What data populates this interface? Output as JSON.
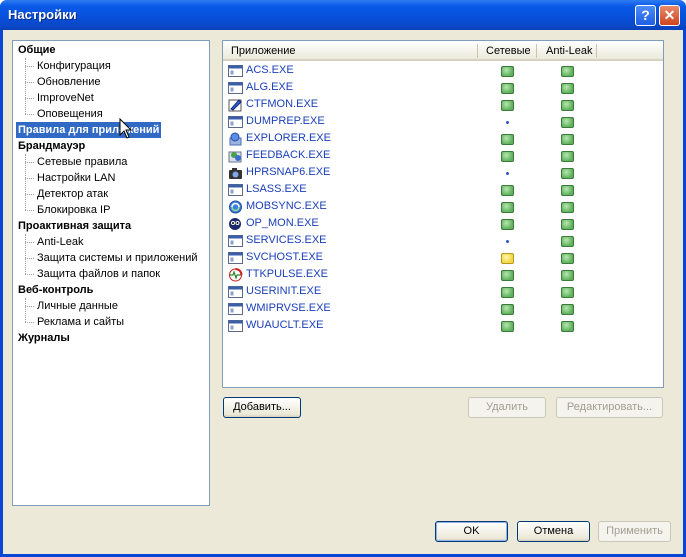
{
  "window": {
    "title": "Настройки",
    "help_button": "?",
    "close_button": "✕"
  },
  "tree": [
    {
      "label": "Общие",
      "type": "category"
    },
    {
      "label": "Конфигурация",
      "type": "item"
    },
    {
      "label": "Обновление",
      "type": "item"
    },
    {
      "label": "ImproveNet",
      "type": "item"
    },
    {
      "label": "Оповещения",
      "type": "item"
    },
    {
      "label": "Правила для приложений",
      "type": "category",
      "selected": true
    },
    {
      "label": "Брандмауэр",
      "type": "category"
    },
    {
      "label": "Сетевые правила",
      "type": "item"
    },
    {
      "label": "Настройки LAN",
      "type": "item"
    },
    {
      "label": "Детектор атак",
      "type": "item"
    },
    {
      "label": "Блокировка IP",
      "type": "item"
    },
    {
      "label": "Проактивная защита",
      "type": "category"
    },
    {
      "label": "Anti-Leak",
      "type": "item"
    },
    {
      "label": "Защита системы и приложений",
      "type": "item"
    },
    {
      "label": "Защита файлов и папок",
      "type": "item"
    },
    {
      "label": "Веб-контроль",
      "type": "category"
    },
    {
      "label": "Личные данные",
      "type": "item"
    },
    {
      "label": "Реклама и сайты",
      "type": "item"
    },
    {
      "label": "Журналы",
      "type": "category"
    }
  ],
  "list": {
    "columns": [
      "Приложение",
      "Сетевые",
      "Anti-Leak"
    ],
    "rows": [
      {
        "name": "ACS.EXE",
        "icon": "window-app-icon",
        "network": "green",
        "antileak": "green"
      },
      {
        "name": "ALG.EXE",
        "icon": "window-app-icon",
        "network": "green",
        "antileak": "green"
      },
      {
        "name": "CTFMON.EXE",
        "icon": "pen-app-icon",
        "network": "green",
        "antileak": "green"
      },
      {
        "name": "DUMPREP.EXE",
        "icon": "window-app-icon",
        "network": "none",
        "antileak": "green"
      },
      {
        "name": "EXPLORER.EXE",
        "icon": "explorer-icon",
        "network": "green",
        "antileak": "green"
      },
      {
        "name": "FEEDBACK.EXE",
        "icon": "feedback-icon",
        "network": "green",
        "antileak": "green"
      },
      {
        "name": "HPRSNAP6.EXE",
        "icon": "camera-icon",
        "network": "none",
        "antileak": "green"
      },
      {
        "name": "LSASS.EXE",
        "icon": "window-app-icon",
        "network": "green",
        "antileak": "green"
      },
      {
        "name": "MOBSYNC.EXE",
        "icon": "sync-icon",
        "network": "green",
        "antileak": "green"
      },
      {
        "name": "OP_MON.EXE",
        "icon": "monitor-icon",
        "network": "green",
        "antileak": "green"
      },
      {
        "name": "SERVICES.EXE",
        "icon": "window-app-icon",
        "network": "none",
        "antileak": "green"
      },
      {
        "name": "SVCHOST.EXE",
        "icon": "window-app-icon",
        "network": "yellow",
        "antileak": "green"
      },
      {
        "name": "TTKPULSE.EXE",
        "icon": "pulse-icon",
        "network": "green",
        "antileak": "green"
      },
      {
        "name": "USERINIT.EXE",
        "icon": "window-app-icon",
        "network": "green",
        "antileak": "green"
      },
      {
        "name": "WMIPRVSE.EXE",
        "icon": "window-app-icon",
        "network": "green",
        "antileak": "green"
      },
      {
        "name": "WUAUCLT.EXE",
        "icon": "window-app-icon",
        "network": "green",
        "antileak": "green"
      }
    ]
  },
  "actions": {
    "add": "Добавить...",
    "delete": "Удалить",
    "edit": "Редактировать..."
  },
  "footer": {
    "ok": "OK",
    "cancel": "Отмена",
    "apply": "Применить"
  },
  "colors": {
    "titlebar": "#0a5ae8",
    "selection": "#316ac5",
    "link": "#1a3fb8",
    "status_green": "#5fb15c",
    "status_yellow": "#f2d43c"
  }
}
